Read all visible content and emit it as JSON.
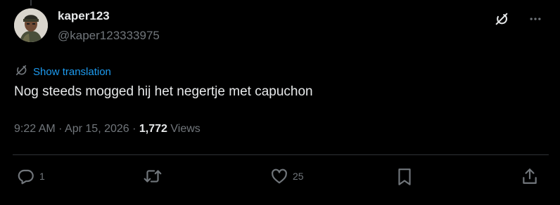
{
  "user": {
    "display_name": "kaper123",
    "handle": "@kaper123333975"
  },
  "translate_label": "Show translation",
  "tweet_text": "Nog steeds mogged hij het negertje met capuchon",
  "meta": {
    "time": "9:22 AM",
    "date": "Apr 15, 2026",
    "sep1": " · ",
    "sep2": " · ",
    "views_count": "1,772",
    "views_label": " Views"
  },
  "actions": {
    "reply_count": "1",
    "like_count": "25"
  },
  "colors": {
    "background": "#000000",
    "primary_text": "#e7e9ea",
    "secondary_text": "#71767b",
    "link": "#1d9bf0",
    "divider": "#2f3336"
  },
  "icons": [
    "grok-icon",
    "more-icon",
    "translate-icon",
    "reply-icon",
    "retweet-icon",
    "like-icon",
    "bookmark-icon",
    "share-icon"
  ]
}
